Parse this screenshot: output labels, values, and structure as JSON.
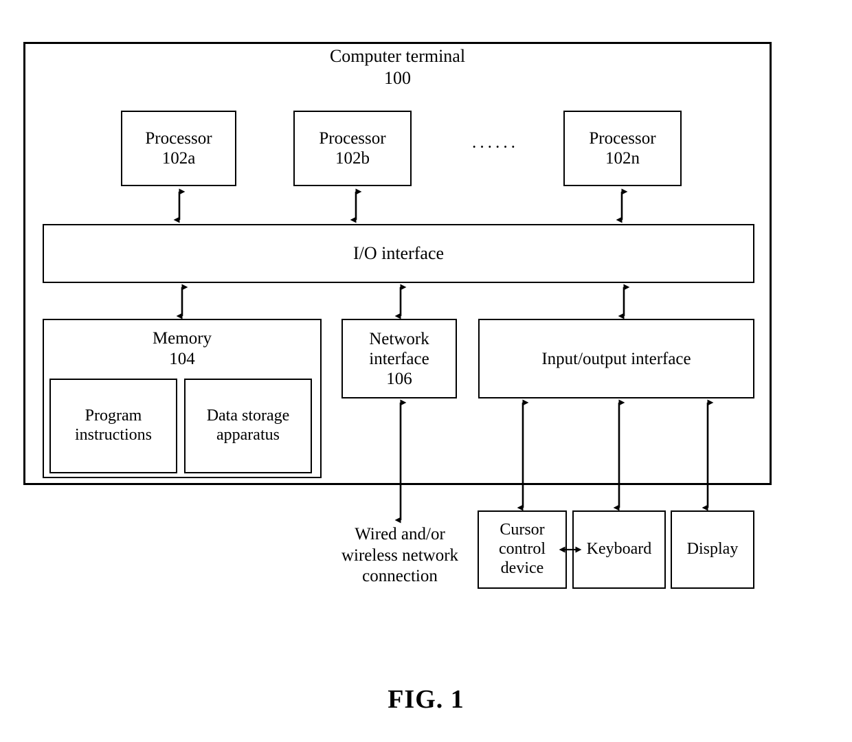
{
  "figure": {
    "caption": "FIG. 1",
    "container_title": "Computer terminal\n100"
  },
  "processors": [
    {
      "name": "processor-102a",
      "label": "Processor\n102a"
    },
    {
      "name": "processor-102b",
      "label": "Processor\n102b"
    },
    {
      "name": "processor-102n",
      "label": "Processor\n102n"
    }
  ],
  "ellipsis": "······",
  "buses": {
    "io_interface": "I/O interface"
  },
  "memory": {
    "title": "Memory\n104",
    "blocks": [
      {
        "name": "program-instructions",
        "label": "Program\ninstructions"
      },
      {
        "name": "data-storage-apparatus",
        "label": "Data storage\napparatus"
      }
    ]
  },
  "network_interface": {
    "label": "Network\ninterface\n106"
  },
  "io_port_interface": {
    "label": "Input/output interface"
  },
  "peripherals": [
    {
      "name": "cursor-control-device",
      "label": "Cursor\ncontrol\ndevice"
    },
    {
      "name": "keyboard",
      "label": "Keyboard"
    },
    {
      "name": "display",
      "label": "Display"
    }
  ],
  "network_connection": {
    "label": "Wired and/or\nwireless network\nconnection"
  },
  "colors": {
    "stroke": "#000000",
    "background": "#ffffff"
  }
}
